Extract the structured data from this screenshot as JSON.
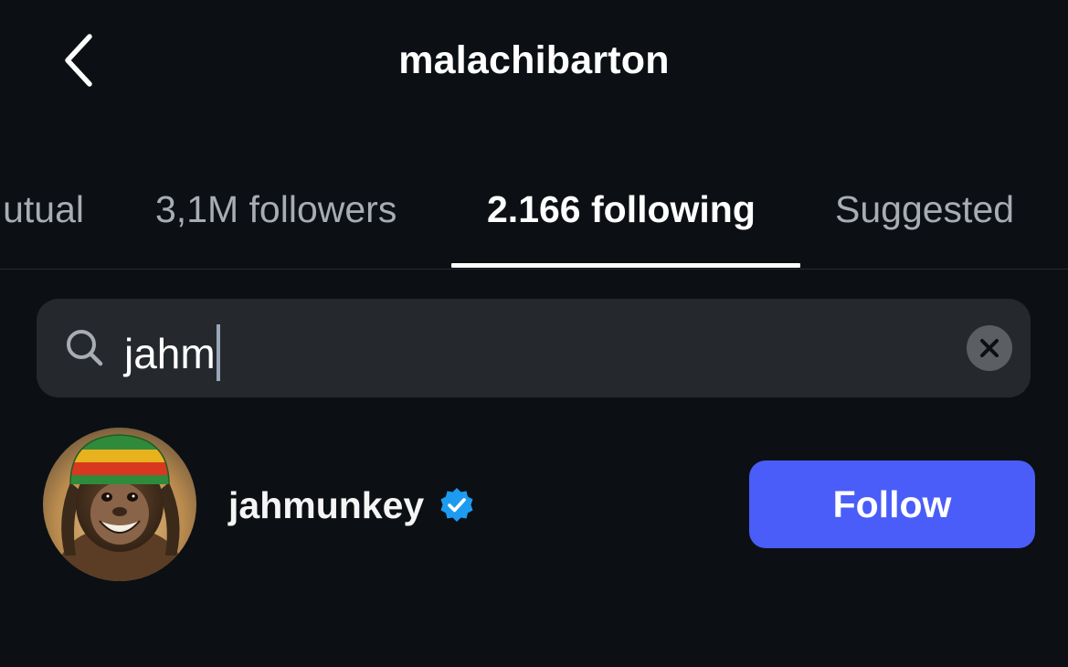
{
  "header": {
    "title": "malachibarton",
    "back_icon": "chevron-left-icon"
  },
  "tabs": [
    {
      "label": "utual",
      "active": false
    },
    {
      "label": "3,1M followers",
      "active": false
    },
    {
      "label": "2.166 following",
      "active": true
    },
    {
      "label": "Suggested",
      "active": false
    }
  ],
  "search": {
    "value": "jahm",
    "icon": "search-icon",
    "clear_icon": "close-icon"
  },
  "results": [
    {
      "username": "jahmunkey",
      "verified": true,
      "button_label": "Follow"
    }
  ],
  "colors": {
    "background": "#0c1014",
    "search_bg": "#25292e",
    "follow_button": "#4a5df9",
    "verified_badge": "#1d9bf0",
    "inactive_tab": "#a8acb3"
  }
}
